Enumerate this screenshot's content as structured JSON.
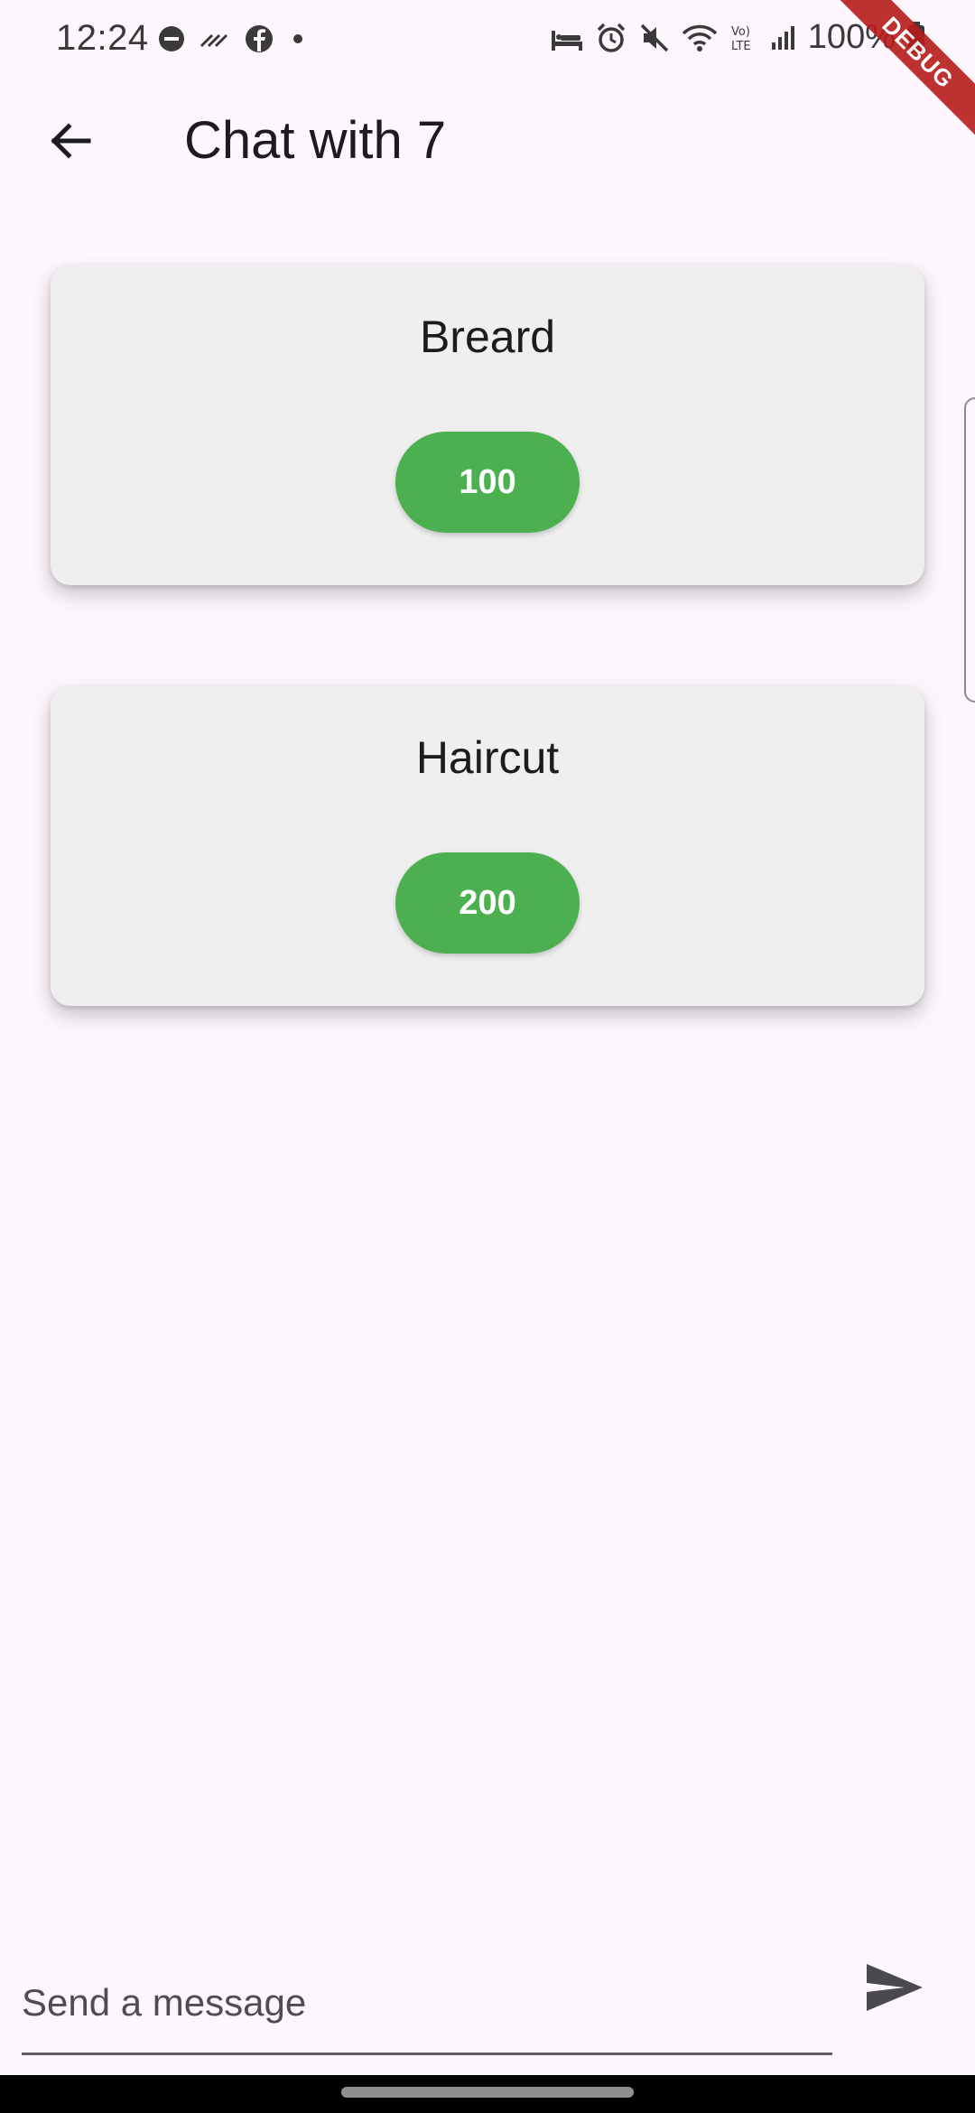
{
  "status_bar": {
    "time": "12:24",
    "battery": "100%",
    "left_icons": [
      "dnd-icon",
      "missed-call-icon",
      "facebook-icon",
      "notification-dot-icon"
    ],
    "right_icons": [
      "sleep-mode-icon",
      "alarm-icon",
      "mute-icon",
      "wifi-icon",
      "volte-icon",
      "signal-icon",
      "battery-icon"
    ]
  },
  "debug_banner": {
    "label": "DEBUG"
  },
  "app_bar": {
    "title": "Chat with 7",
    "back_icon": "arrow-back-icon"
  },
  "services": [
    {
      "name": "Breard",
      "price": "100"
    },
    {
      "name": "Haircut",
      "price": "200"
    }
  ],
  "message_bar": {
    "value": "",
    "placeholder": "Send a message",
    "send_icon": "send-icon"
  },
  "colors": {
    "background": "#fdf7fd",
    "card": "#efefef",
    "accent": "#4caf50",
    "debug": "#b71c1c"
  }
}
